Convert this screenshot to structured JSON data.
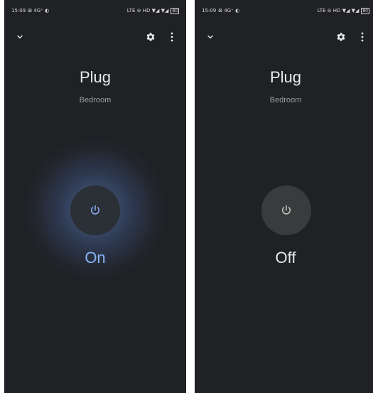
{
  "colors": {
    "background": "#202124",
    "icon": "#e8eaed",
    "on_accent": "#8ab4f8",
    "off_text": "#e8eaed",
    "subtitle": "#9aa0a6"
  },
  "screens": [
    {
      "status_bar": {
        "time": "15:09",
        "extras": "⊠ 4G⁺ ◐",
        "network": "LTE ⊜ HD ▼◢ ▼◢",
        "battery": "80"
      },
      "icons": {
        "back": "chevron-down-icon",
        "settings": "gear-icon",
        "more": "more-vert-icon",
        "power": "power-icon"
      },
      "device_name": "Plug",
      "room": "Bedroom",
      "state_label": "On",
      "is_on": true
    },
    {
      "status_bar": {
        "time": "15:09",
        "extras": "⊠ 4G⁺ ◐",
        "network": "LTE ⊜ HD ▼◢ ▼◢",
        "battery": "80"
      },
      "icons": {
        "back": "chevron-down-icon",
        "settings": "gear-icon",
        "more": "more-vert-icon",
        "power": "power-icon"
      },
      "device_name": "Plug",
      "room": "Bedroom",
      "state_label": "Off",
      "is_on": false
    }
  ]
}
